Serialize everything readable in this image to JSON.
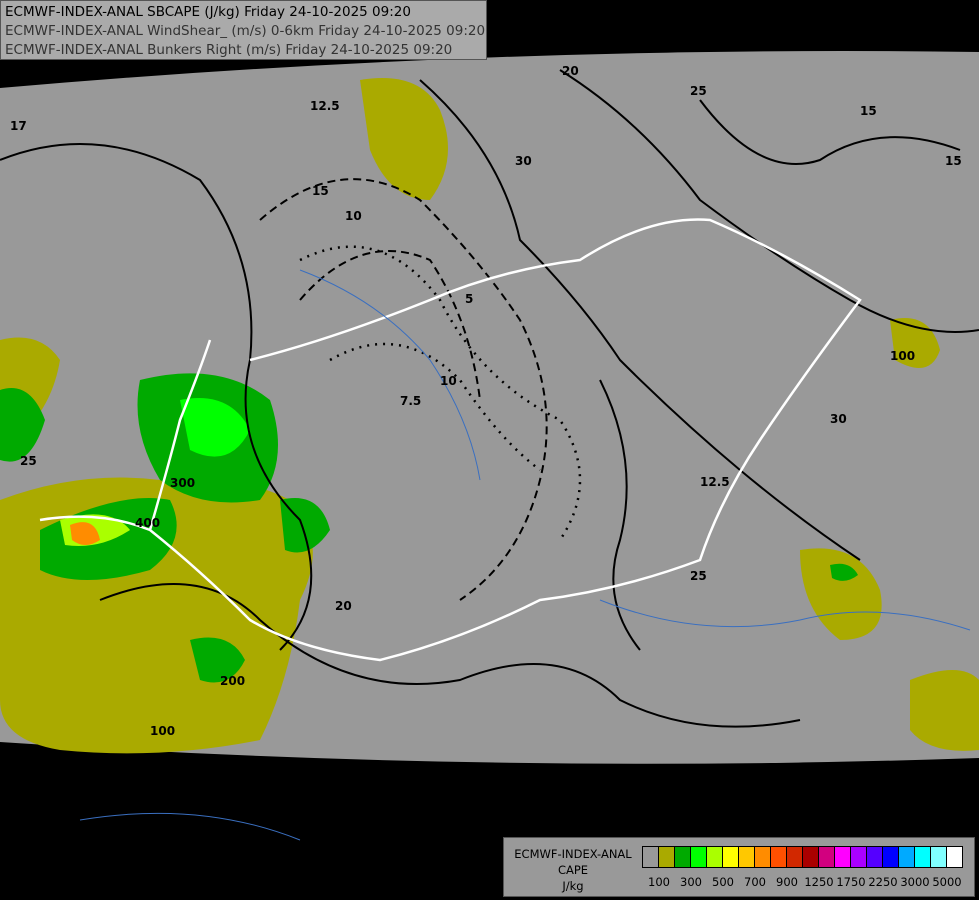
{
  "titles": [
    "ECMWF-INDEX-ANAL SBCAPE (J/kg) Friday 24-10-2025 09:20",
    "ECMWF-INDEX-ANAL WindShear_ (m/s) 0-6km Friday 24-10-2025 09:20",
    "ECMWF-INDEX-ANAL Bunkers Right (m/s) Friday 24-10-2025 09:20"
  ],
  "legend": {
    "model": "ECMWF-INDEX-ANAL",
    "variable": "CAPE",
    "unit": "J/kg",
    "colors": [
      "#999999",
      "#aaaa00",
      "#00aa00",
      "#00ff00",
      "#aaff00",
      "#ffff00",
      "#ffc800",
      "#ff8c00",
      "#ff5000",
      "#d22800",
      "#aa0000",
      "#d2007f",
      "#ff00ff",
      "#aa00ff",
      "#5500ff",
      "#0000ff",
      "#00aaff",
      "#00ffff",
      "#80ffff",
      "#ffffff"
    ],
    "ticks": [
      "100",
      "300",
      "500",
      "700",
      "900",
      "1250",
      "1750",
      "2250",
      "3000",
      "5000"
    ]
  },
  "contour_labels": [
    "20",
    "17",
    "15",
    "12.5",
    "10",
    "7.5",
    "5",
    "25",
    "30",
    "100",
    "200",
    "300",
    "400"
  ]
}
